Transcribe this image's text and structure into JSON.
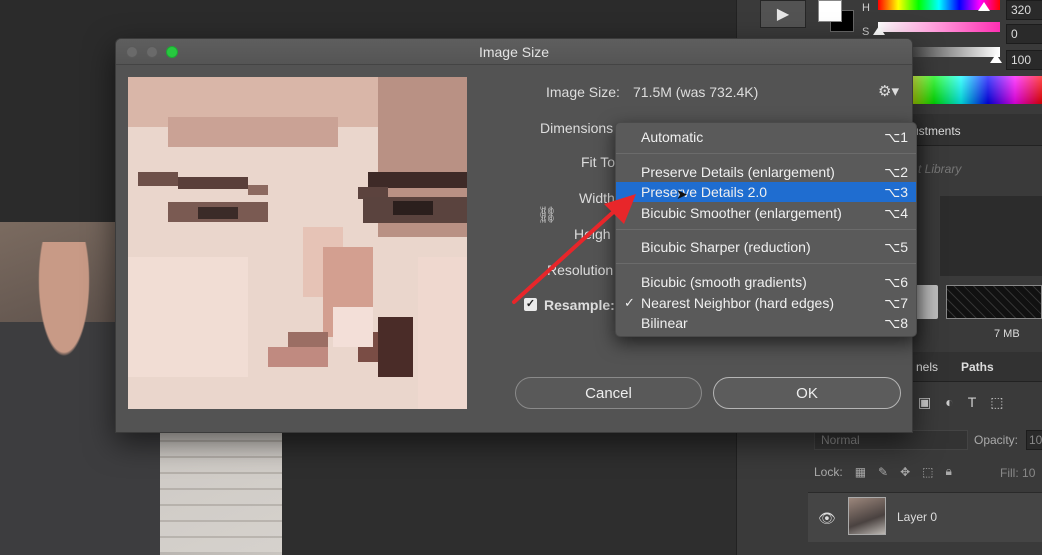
{
  "dialog": {
    "title": "Image Size",
    "image_size_label": "Image Size:",
    "image_size_value": "71.5M (was 732.4K)",
    "dimensions_label": "Dimensions",
    "fit_to_label": "Fit To",
    "width_label": "Width",
    "height_label": "Heigh",
    "resolution_label": "Resolution",
    "resample_label": "Resample:",
    "resample_checked": true,
    "cancel_label": "Cancel",
    "ok_label": "OK"
  },
  "resample_menu": {
    "items": [
      {
        "label": "Automatic",
        "shortcut": "⌥1",
        "checked": false,
        "active": false
      },
      {
        "label": "Preserve Details (enlargement)",
        "shortcut": "⌥2",
        "checked": false,
        "active": false
      },
      {
        "label": "Preserve Details 2.0",
        "shortcut": "⌥3",
        "checked": false,
        "active": true
      },
      {
        "label": "Bicubic Smoother (enlargement)",
        "shortcut": "⌥4",
        "checked": false,
        "active": false
      },
      {
        "label": "Bicubic Sharper (reduction)",
        "shortcut": "⌥5",
        "checked": false,
        "active": false
      },
      {
        "label": "Bicubic (smooth gradients)",
        "shortcut": "⌥6",
        "checked": false,
        "active": false
      },
      {
        "label": "Nearest Neighbor (hard edges)",
        "shortcut": "⌥7",
        "checked": true,
        "active": false
      },
      {
        "label": "Bilinear",
        "shortcut": "⌥8",
        "checked": false,
        "active": false
      }
    ]
  },
  "color_panel": {
    "h_label": "H",
    "s_label": "S",
    "h_value": "320",
    "s_value": "0",
    "b_value": "100",
    "accent_color": "#ff2fb3"
  },
  "panels": {
    "adjustments_tab": "ustments",
    "library_placeholder": "t Library",
    "size_text": "7 MB",
    "channels_tab": "nels",
    "paths_tab": "Paths",
    "blend_mode": "Normal",
    "opacity_label": "Opacity:",
    "opacity_value": "10",
    "lock_label": "Lock:",
    "fill_label": "Fill:",
    "fill_value": "10",
    "layer_name": "Layer 0"
  },
  "annotation": {
    "arrow_color": "#e8262a"
  }
}
